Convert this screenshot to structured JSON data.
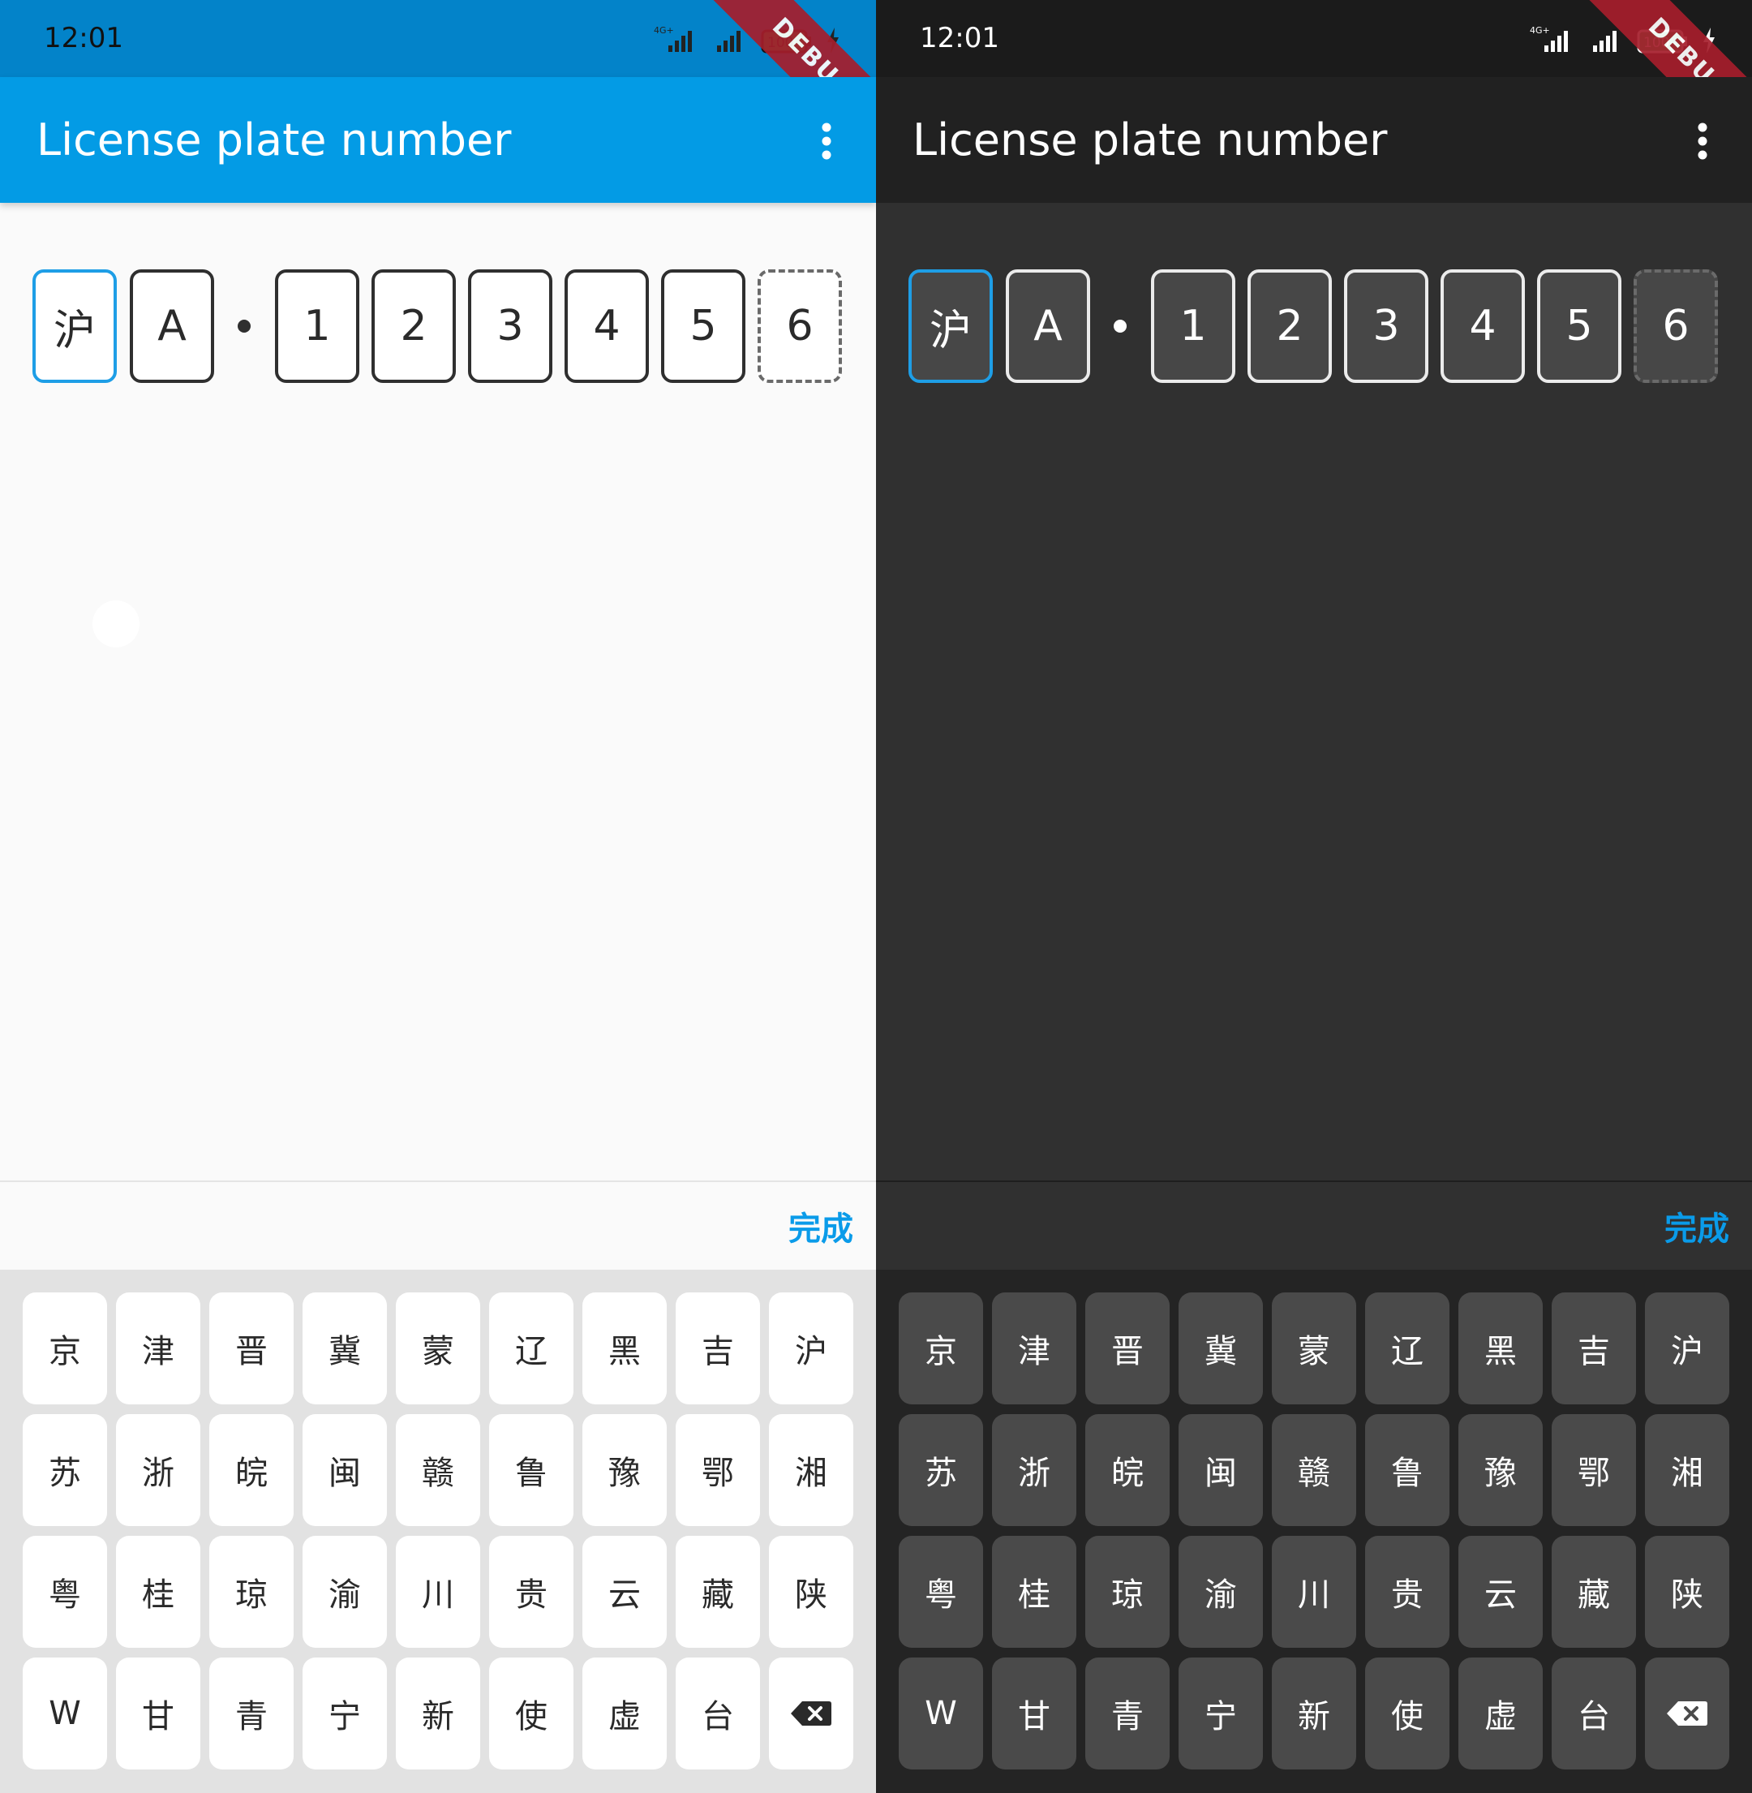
{
  "colors": {
    "accent": "#039be5",
    "done_text": "#0a9be9",
    "debug_banner": "#a61e2c",
    "battery_fill": "#22b14c"
  },
  "screens": [
    {
      "theme": "light",
      "status_bar": {
        "time": "12:01",
        "network": "4G+",
        "battery": "100",
        "debug_label": "DEBUG"
      },
      "app_bar": {
        "title": "License plate number",
        "menu_icon": "more-vert-icon"
      },
      "plate": {
        "chars": [
          "沪",
          "A",
          "1",
          "2",
          "3",
          "4",
          "5",
          "6"
        ],
        "active_index": 0,
        "pending_index": 7
      },
      "done_label": "完成",
      "keyboard": {
        "rows": [
          [
            "京",
            "津",
            "晋",
            "冀",
            "蒙",
            "辽",
            "黑",
            "吉",
            "沪"
          ],
          [
            "苏",
            "浙",
            "皖",
            "闽",
            "赣",
            "鲁",
            "豫",
            "鄂",
            "湘"
          ],
          [
            "粤",
            "桂",
            "琼",
            "渝",
            "川",
            "贵",
            "云",
            "藏",
            "陕"
          ],
          [
            "W",
            "甘",
            "青",
            "宁",
            "新",
            "使",
            "虚",
            "台"
          ]
        ],
        "delete_icon": "backspace-icon"
      }
    },
    {
      "theme": "dark",
      "status_bar": {
        "time": "12:01",
        "network": "4G+",
        "battery": "100",
        "debug_label": "DEBUG"
      },
      "app_bar": {
        "title": "License plate number",
        "menu_icon": "more-vert-icon"
      },
      "plate": {
        "chars": [
          "沪",
          "A",
          "1",
          "2",
          "3",
          "4",
          "5",
          "6"
        ],
        "active_index": 0,
        "pending_index": 7
      },
      "done_label": "完成",
      "keyboard": {
        "rows": [
          [
            "京",
            "津",
            "晋",
            "冀",
            "蒙",
            "辽",
            "黑",
            "吉",
            "沪"
          ],
          [
            "苏",
            "浙",
            "皖",
            "闽",
            "赣",
            "鲁",
            "豫",
            "鄂",
            "湘"
          ],
          [
            "粤",
            "桂",
            "琼",
            "渝",
            "川",
            "贵",
            "云",
            "藏",
            "陕"
          ],
          [
            "W",
            "甘",
            "青",
            "宁",
            "新",
            "使",
            "虚",
            "台"
          ]
        ],
        "delete_icon": "backspace-icon"
      }
    }
  ]
}
